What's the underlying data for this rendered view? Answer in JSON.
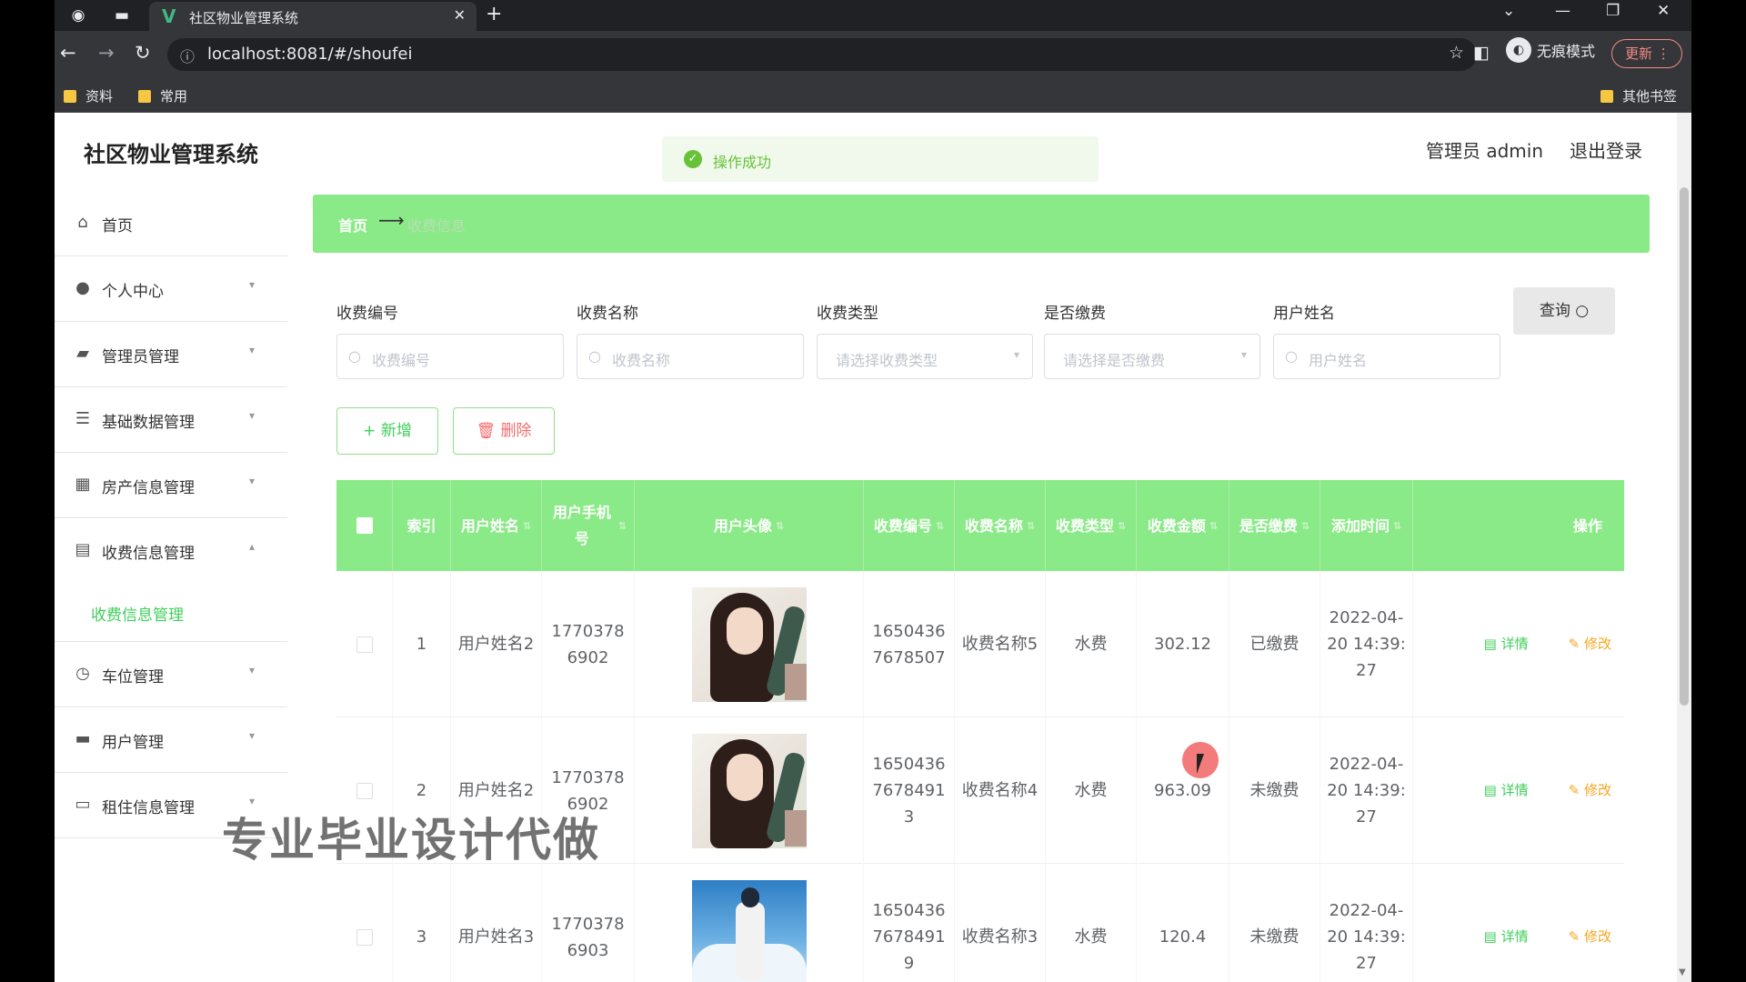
{
  "browser": {
    "tab_title": "社区物业管理系统",
    "tab_close": "✕",
    "new_tab": "+",
    "url": "localhost:8081/#/shoufei",
    "incognito_label": "无痕模式",
    "update_label": "更新",
    "bookmarks": [
      "资料",
      "常用"
    ],
    "other_bookmarks": "其他书签"
  },
  "header": {
    "app_title": "社区物业管理系统",
    "toast": "操作成功",
    "admin_label": "管理员 admin",
    "logout": "退出登录"
  },
  "sidebar": {
    "items": [
      {
        "label": "首页",
        "icon": "home-icon"
      },
      {
        "label": "个人中心",
        "icon": "user-icon"
      },
      {
        "label": "管理员管理",
        "icon": "admin-icon"
      },
      {
        "label": "基础数据管理",
        "icon": "list-icon"
      },
      {
        "label": "房产信息管理",
        "icon": "grid-icon"
      },
      {
        "label": "收费信息管理",
        "icon": "clipboard-icon"
      },
      {
        "label": "车位管理",
        "icon": "clock-icon"
      },
      {
        "label": "用户管理",
        "icon": "card-icon"
      },
      {
        "label": "租住信息管理",
        "icon": "monitor-icon"
      }
    ],
    "active_submenu": "收费信息管理"
  },
  "breadcrumb": {
    "home": "首页",
    "current": "收费信息"
  },
  "filters": {
    "fields": [
      {
        "label": "收费编号",
        "placeholder": "收费编号"
      },
      {
        "label": "收费名称",
        "placeholder": "收费名称"
      },
      {
        "label": "收费类型",
        "placeholder": "请选择收费类型"
      },
      {
        "label": "是否缴费",
        "placeholder": "请选择是否缴费"
      },
      {
        "label": "用户姓名",
        "placeholder": "用户姓名"
      }
    ],
    "query_label": "查询"
  },
  "actions": {
    "add_label": "+ 新增",
    "delete_label": "删除"
  },
  "table": {
    "headers": [
      "索引",
      "用户姓名",
      "用户手机号",
      "用户头像",
      "收费编号",
      "收费名称",
      "收费类型",
      "收费金额",
      "是否缴费",
      "添加时间",
      "操作"
    ],
    "detail_label": "详情",
    "edit_label": "修改",
    "rows": [
      {
        "index": "1",
        "user_name": "用户姓名2",
        "phone": "17703786902",
        "avatar": "girl",
        "charge_no": "16504367678507",
        "charge_name": "收费名称5",
        "charge_type": "水费",
        "amount": "302.12",
        "paid": "已缴费",
        "added": "2022-04-20 14:39:27"
      },
      {
        "index": "2",
        "user_name": "用户姓名2",
        "phone": "17703786902",
        "avatar": "girl",
        "charge_no": "165043676784913",
        "charge_name": "收费名称4",
        "charge_type": "水费",
        "amount": "963.09",
        "paid": "未缴费",
        "added": "2022-04-20 14:39:27"
      },
      {
        "index": "3",
        "user_name": "用户姓名3",
        "phone": "17703786903",
        "avatar": "boy",
        "charge_no": "165043676784919",
        "charge_name": "收费名称3",
        "charge_type": "水费",
        "amount": "120.4",
        "paid": "未缴费",
        "added": "2022-04-20 14:39:27"
      }
    ]
  },
  "watermark": "专业毕业设计代做",
  "colors": {
    "accent": "#8bea88",
    "accent_text": "#3ecf5a",
    "danger": "#f56c6c",
    "warning": "#f5a623"
  }
}
